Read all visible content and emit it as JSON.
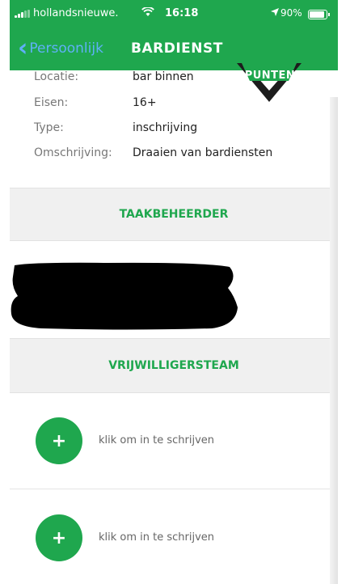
{
  "status_bar": {
    "carrier": "hollandsnieuwe.",
    "time": "16:18",
    "battery": "90%",
    "battery_level": 0.9
  },
  "nav": {
    "back_label": "Persoonlijk",
    "title": "BARDIENST"
  },
  "badge": {
    "label": "PUNTEN"
  },
  "details": [
    {
      "key": "Locatie:",
      "value": "bar binnen"
    },
    {
      "key": "Eisen:",
      "value": "16+"
    },
    {
      "key": "Type:",
      "value": "inschrijving"
    },
    {
      "key": "Omschrijving:",
      "value": "Draaien van bardiensten"
    }
  ],
  "sections": {
    "manager": "TAAKBEHEERDER",
    "team": "VRIJWILLIGERSTEAM"
  },
  "signups": [
    {
      "icon": "+",
      "label": "klik om in te schrijven"
    },
    {
      "icon": "+",
      "label": "klik om in te schrijven"
    }
  ],
  "colors": {
    "brand_green": "#1fa74e",
    "back_blue": "#5fb0f7",
    "section_bg": "#f0f0f0"
  }
}
